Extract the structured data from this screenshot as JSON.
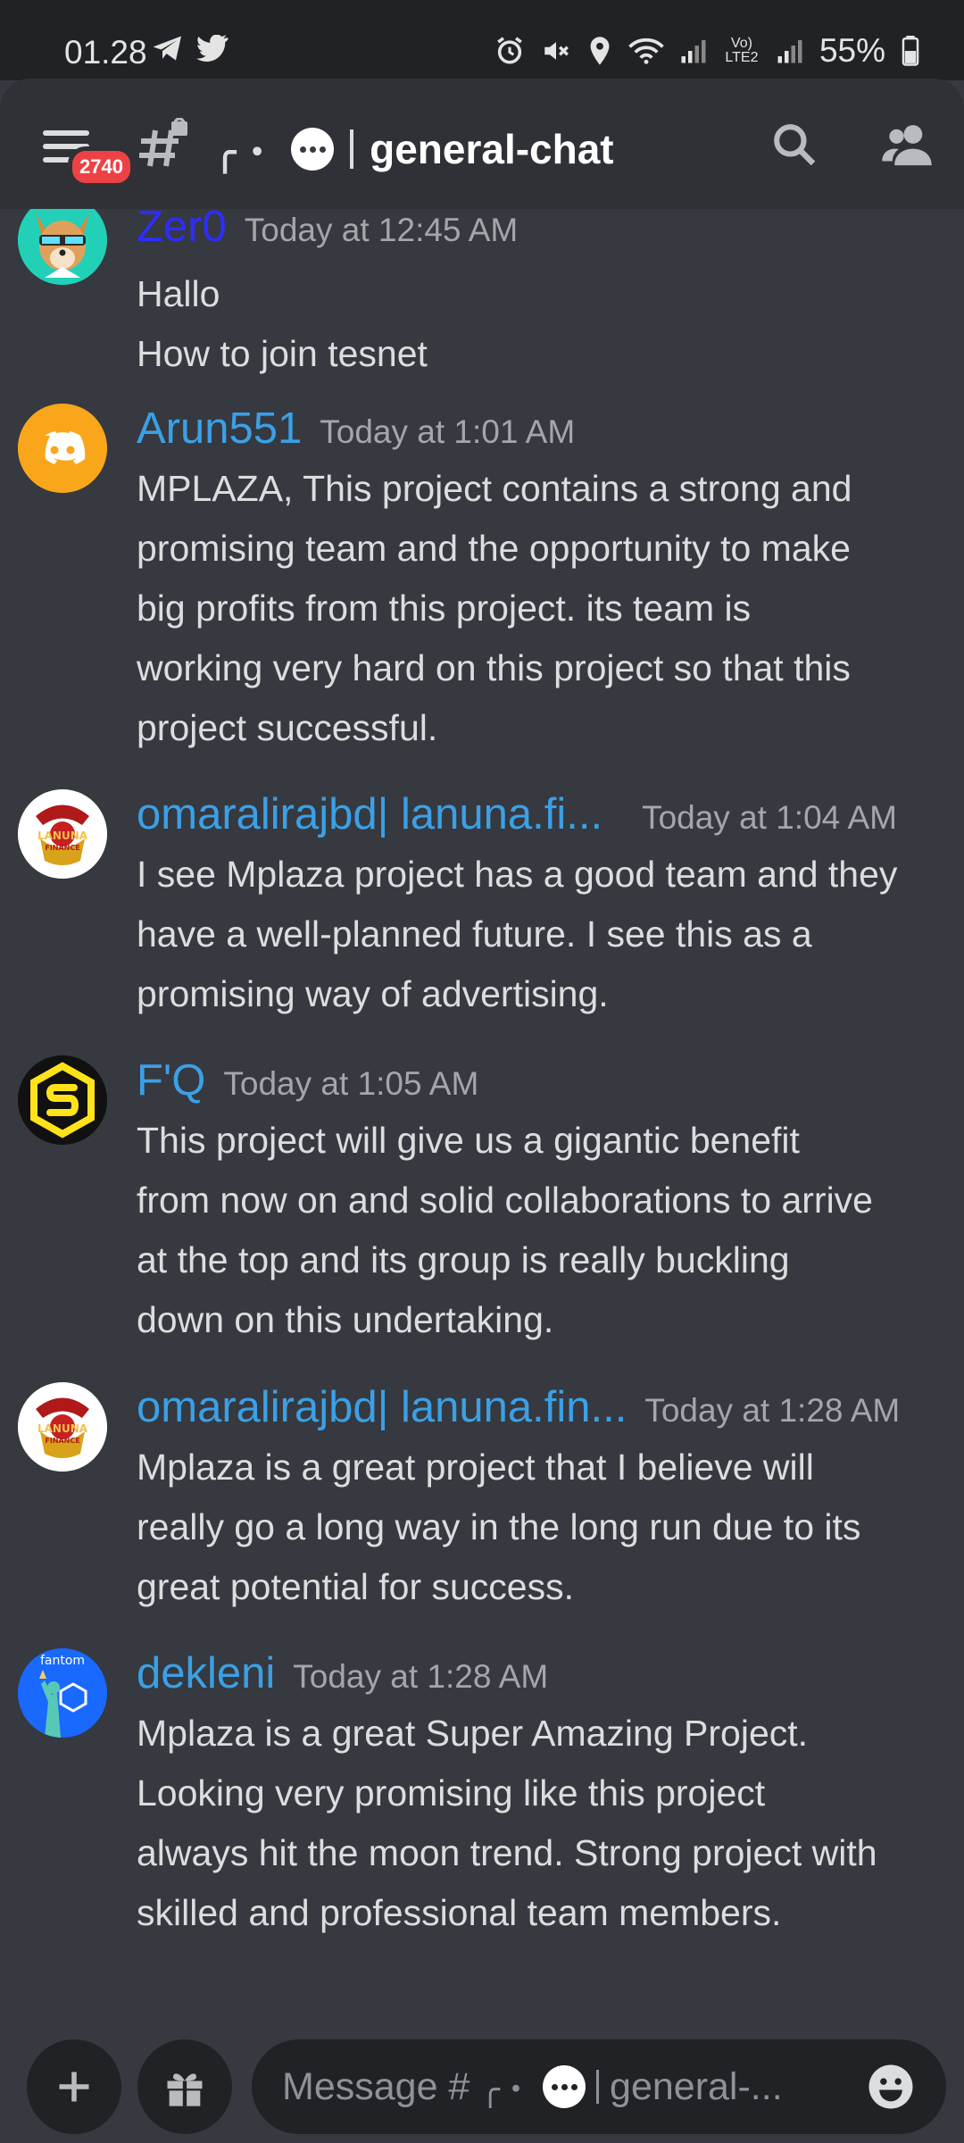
{
  "status_bar": {
    "time": "01.28",
    "network": "Vo) LTE2",
    "battery": "55%"
  },
  "header": {
    "notification_count": "2740",
    "channel_name": "general-chat",
    "channel_deco": "╭・"
  },
  "messages": [
    {
      "author": "Zer0",
      "author_color": "#2d2dff",
      "timestamp": "Today at 12:45 AM",
      "lines": [
        "Hallo",
        "How to join tesnet"
      ]
    },
    {
      "author": "Arun551",
      "author_color": "#3ba0e6",
      "timestamp": "Today at 1:01 AM",
      "lines": [
        "MPLAZA, This project contains a strong and",
        "promising team and the opportunity to make",
        "big profits from this project. its team is",
        "working very hard on this project so that this",
        "project successful."
      ]
    },
    {
      "author": "omaralirajbd| lanuna.fi...",
      "author_color": "#3ba0e6",
      "timestamp": "Today at 1:04 AM",
      "lines": [
        "I see Mplaza project has a good team and they",
        "have a well-planned future. I see this as a",
        "promising way of advertising."
      ]
    },
    {
      "author": "F'Q",
      "author_color": "#3ba0e6",
      "timestamp": "Today at 1:05 AM",
      "lines": [
        "This project will give us a gigantic benefit",
        "from now on and solid collaborations to arrive",
        "at the top and its group is really buckling",
        "down on this undertaking."
      ]
    },
    {
      "author": "omaralirajbd| lanuna.fin...",
      "author_color": "#3ba0e6",
      "timestamp": "Today at 1:28 AM",
      "lines": [
        "Mplaza is a great project that I believe will",
        "really go a long way in the long run due to its",
        "great potential for success."
      ]
    },
    {
      "author": "dekleni",
      "author_color": "#3ba0e6",
      "timestamp": "Today at 1:28 AM",
      "lines": [
        "Mplaza is a great Super Amazing Project.",
        "Looking very promising like this project",
        "always hit the moon trend. Strong project with",
        "skilled and professional team members."
      ]
    }
  ],
  "avatars": {
    "lanuna_text": "LANUNA FINANCE",
    "fantom_text": "fantom"
  },
  "composer": {
    "placeholder_prefix": "Message #",
    "placeholder_suffix": "general-..."
  }
}
